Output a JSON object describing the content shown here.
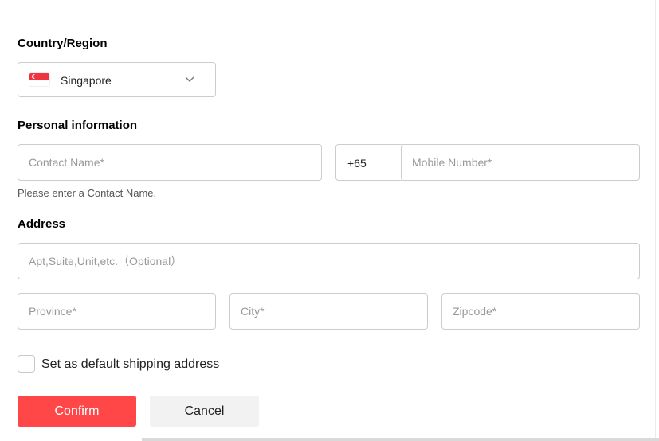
{
  "country_section": {
    "title": "Country/Region",
    "selected": "Singapore",
    "flag_icon": "singapore-flag-icon",
    "dropdown_icon": "chevron-down-icon"
  },
  "personal_section": {
    "title": "Personal information",
    "contact_name": {
      "placeholder": "Contact Name*",
      "value": ""
    },
    "phone_code": "+65",
    "mobile_number": {
      "placeholder": "Mobile Number*",
      "value": ""
    },
    "error_hint": "Please enter a Contact Name."
  },
  "address_section": {
    "title": "Address",
    "apt": {
      "placeholder": "Apt,Suite,Unit,etc.（Optional）",
      "value": ""
    },
    "province": {
      "placeholder": "Province*",
      "value": ""
    },
    "city": {
      "placeholder": "City*",
      "value": ""
    },
    "zipcode": {
      "placeholder": "Zipcode*",
      "value": ""
    }
  },
  "default_address": {
    "label": "Set as default shipping address",
    "checked": false
  },
  "actions": {
    "confirm_label": "Confirm",
    "cancel_label": "Cancel"
  },
  "colors": {
    "primary": "#ff4747",
    "secondary_button": "#f2f2f2",
    "border": "#cccccc",
    "placeholder": "#999999"
  }
}
